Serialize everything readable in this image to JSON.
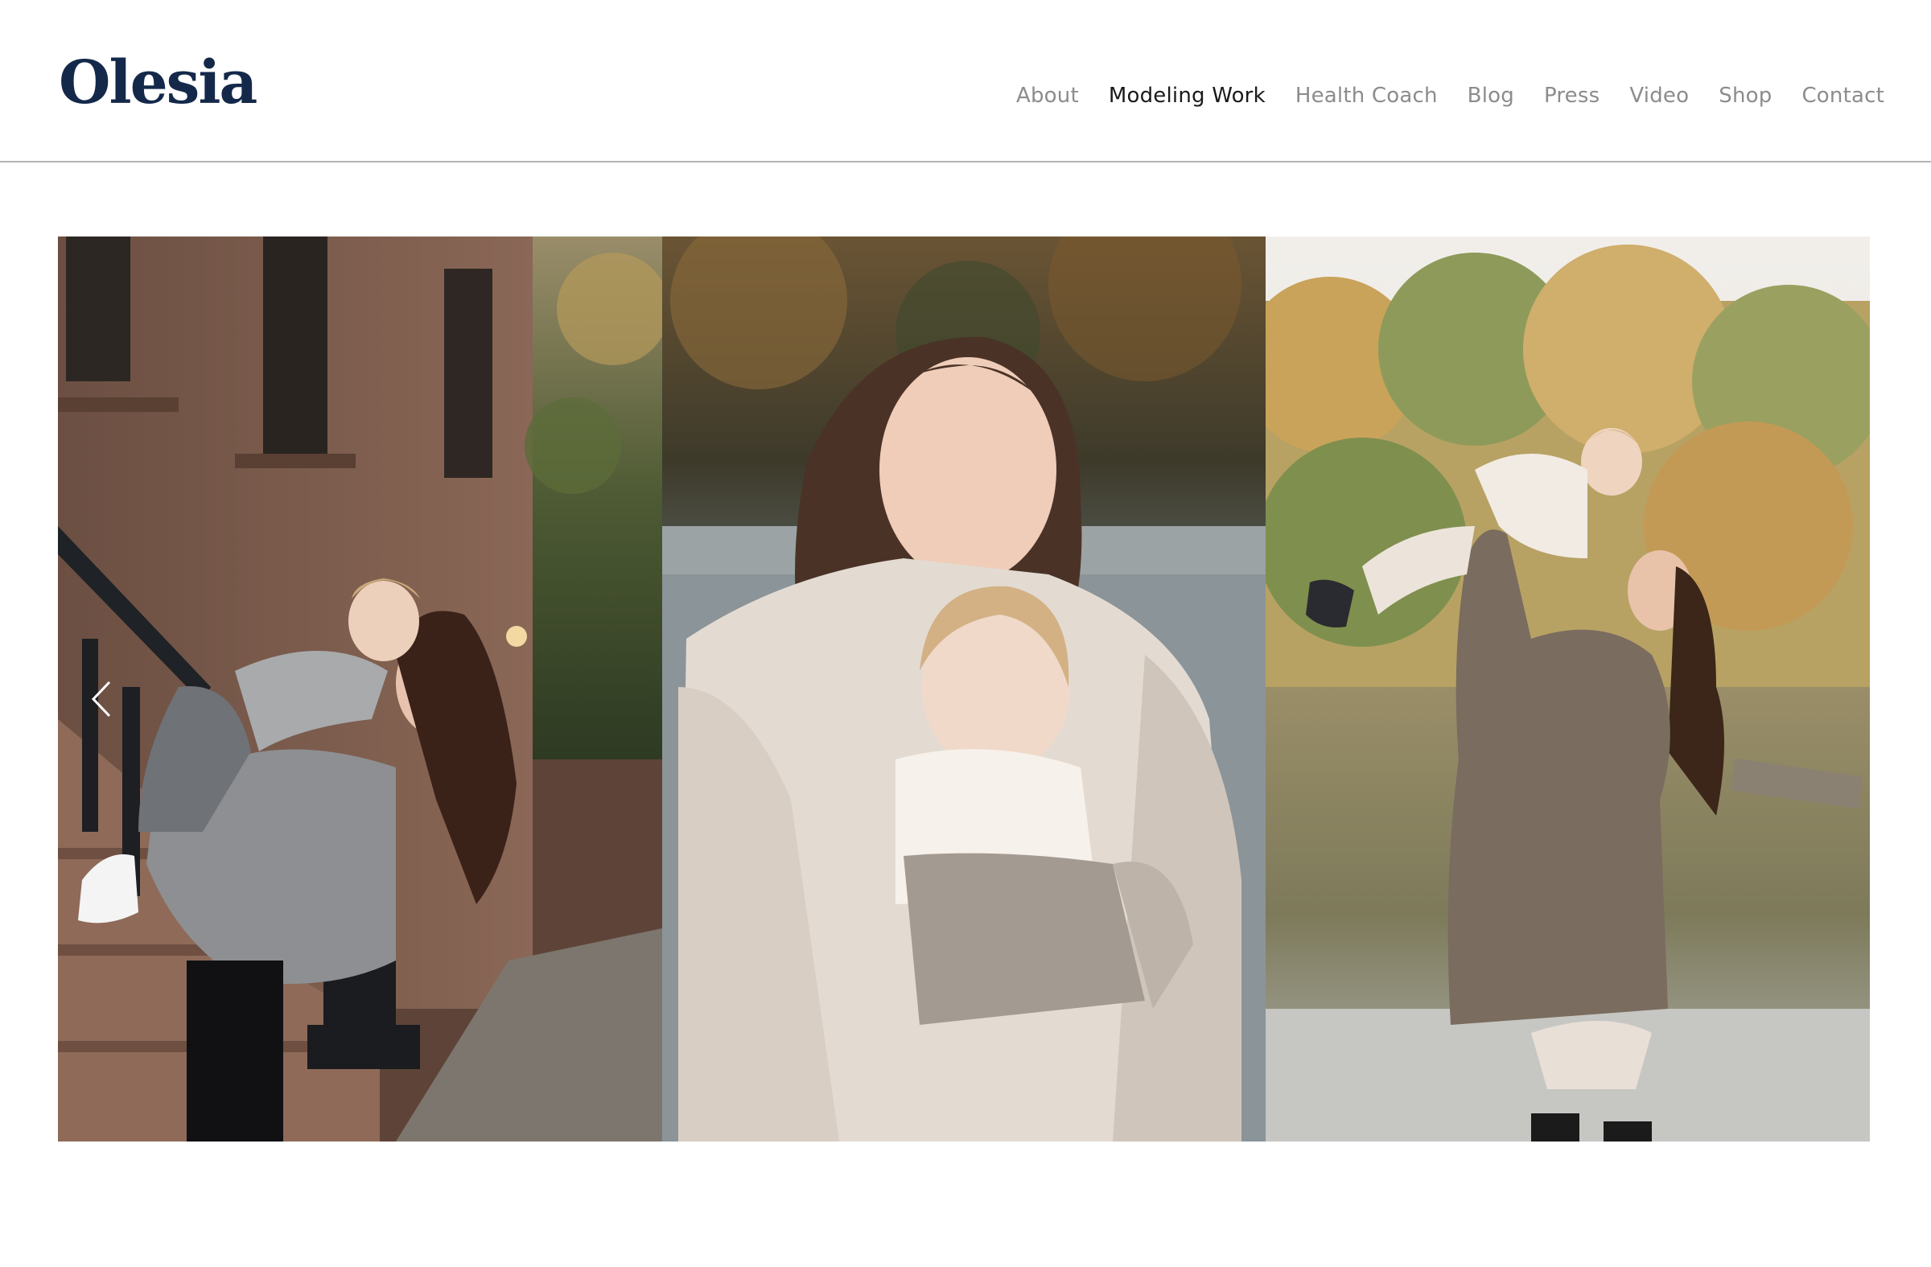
{
  "site": {
    "logo": "Olesia"
  },
  "nav": {
    "items": [
      {
        "label": "About",
        "active": false
      },
      {
        "label": "Modeling Work",
        "active": true
      },
      {
        "label": "Health Coach",
        "active": false
      },
      {
        "label": "Blog",
        "active": false
      },
      {
        "label": "Press",
        "active": false
      },
      {
        "label": "Video",
        "active": false
      },
      {
        "label": "Shop",
        "active": false
      },
      {
        "label": "Contact",
        "active": false
      }
    ]
  },
  "gallery": {
    "prev_icon": "chevron-left-icon",
    "next_icon": "chevron-right-icon",
    "slides": [
      {
        "scene": "brownstone-steps"
      },
      {
        "scene": "lakeside-blanket"
      },
      {
        "scene": "lake-autumn"
      }
    ]
  },
  "colors": {
    "logo": "#14294a",
    "nav_default": "#8c8c8c",
    "nav_active": "#1a1a1a",
    "divider": "#b4b4b4"
  }
}
